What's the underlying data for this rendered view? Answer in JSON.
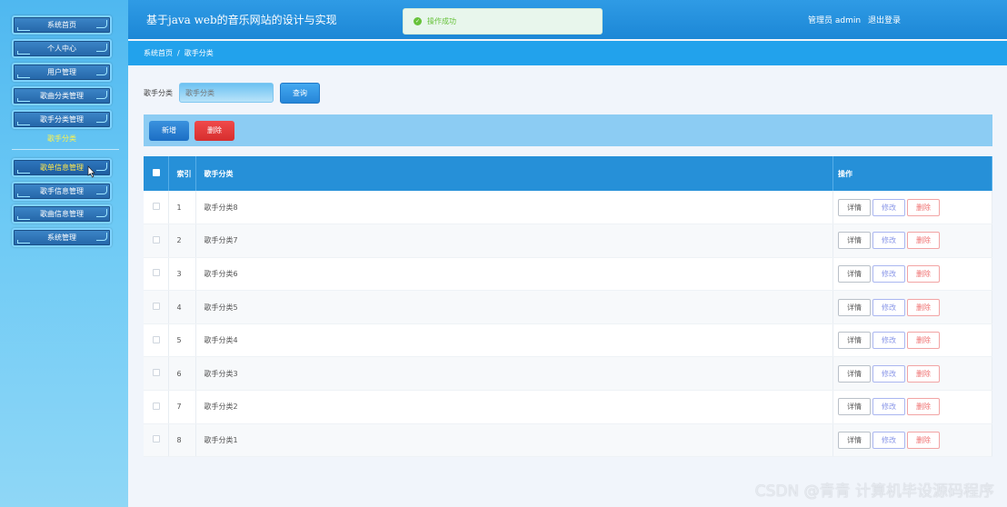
{
  "sidebar": {
    "items": [
      {
        "label": "系统首页"
      },
      {
        "label": "个人中心"
      },
      {
        "label": "用户管理"
      },
      {
        "label": "歌曲分类管理"
      },
      {
        "label": "歌手分类管理"
      },
      {
        "label": "歌单信息管理"
      },
      {
        "label": "歌手信息管理"
      },
      {
        "label": "歌曲信息管理"
      },
      {
        "label": "系统管理"
      }
    ],
    "sub_item": "歌手分类"
  },
  "header": {
    "title": "基于java web的音乐网站的设计与实现",
    "user": "管理员 admin",
    "logout": "退出登录"
  },
  "toast": {
    "text": "操作成功"
  },
  "breadcrumb": {
    "home": "系统首页",
    "separator": "/",
    "current": "歌手分类"
  },
  "search": {
    "label": "歌手分类",
    "placeholder": "歌手分类",
    "button": "查询"
  },
  "actions": {
    "add": "新增",
    "delete": "删除"
  },
  "table": {
    "headers": {
      "index": "索引",
      "name": "歌手分类",
      "ops": "操作"
    },
    "ops": {
      "detail": "详情",
      "edit": "修改",
      "delete": "删除"
    },
    "rows": [
      {
        "index": "1",
        "name": "歌手分类8"
      },
      {
        "index": "2",
        "name": "歌手分类7"
      },
      {
        "index": "3",
        "name": "歌手分类6"
      },
      {
        "index": "4",
        "name": "歌手分类5"
      },
      {
        "index": "5",
        "name": "歌手分类4"
      },
      {
        "index": "6",
        "name": "歌手分类3"
      },
      {
        "index": "7",
        "name": "歌手分类2"
      },
      {
        "index": "8",
        "name": "歌手分类1"
      }
    ]
  },
  "watermark": "CSDN @青青  计算机毕设源码程序",
  "colors": {
    "header": "#1c87d6",
    "sidebar": "#4fb8f0",
    "accent": "#2690d8",
    "danger": "#d62e2e",
    "success": "#67c23a"
  }
}
